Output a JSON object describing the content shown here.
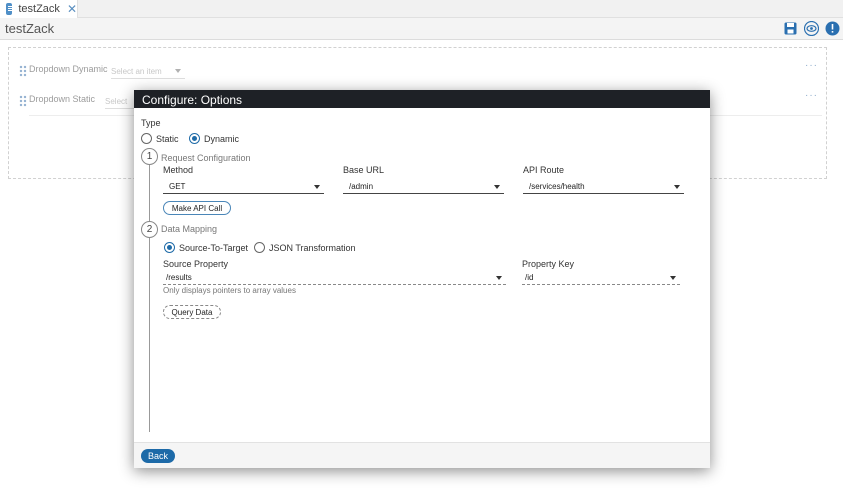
{
  "tab": {
    "label": "testZack",
    "close_glyph": "✕"
  },
  "page": {
    "title": "testZack"
  },
  "colors": {
    "accent": "#1d6aa8",
    "header": "#1e2126"
  },
  "toolbar": {
    "icons": [
      "save-icon",
      "preview-eye-icon",
      "info-icon"
    ]
  },
  "canvas": {
    "fields": [
      {
        "label": "Dropdown Dynamic",
        "placeholder": "Select an item",
        "menu": "···"
      },
      {
        "label": "Dropdown Static",
        "placeholder": "Select",
        "menu": "···"
      }
    ]
  },
  "modal": {
    "title": "Configure: Options",
    "type_label": "Type",
    "type_options": [
      {
        "label": "Static",
        "selected": false
      },
      {
        "label": "Dynamic",
        "selected": true
      }
    ],
    "step1": {
      "number": "1",
      "title": "Request Configuration",
      "method_label": "Method",
      "method_value": "GET",
      "base_url_label": "Base URL",
      "base_url_value": "/admin",
      "api_route_label": "API Route",
      "api_route_value": "/services/health",
      "make_call_label": "Make API Call"
    },
    "step2": {
      "number": "2",
      "title": "Data Mapping",
      "mapping_options": [
        {
          "label": "Source-To-Target",
          "selected": true
        },
        {
          "label": "JSON Transformation",
          "selected": false
        }
      ],
      "source_property_label": "Source Property",
      "source_property_value": "/results",
      "source_hint": "Only displays pointers to array values",
      "property_key_label": "Property Key",
      "property_key_value": "/id",
      "query_label": "Query Data"
    },
    "back_label": "Back"
  }
}
